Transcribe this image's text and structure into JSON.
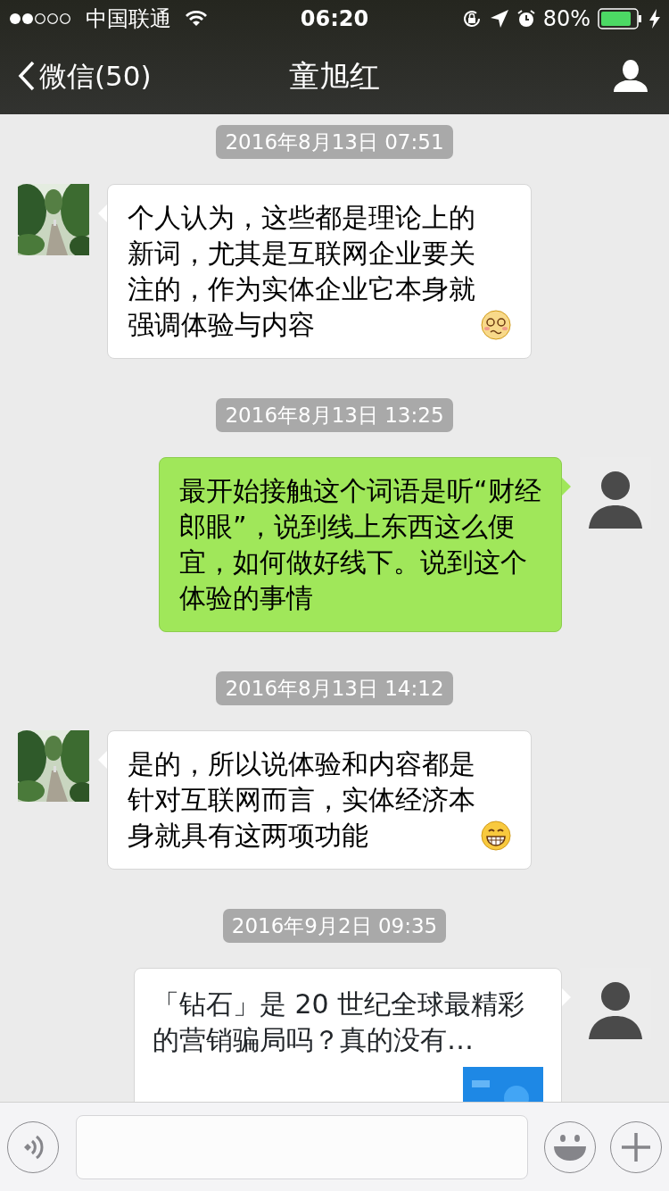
{
  "status_bar": {
    "carrier": "中国联通",
    "time": "06:20",
    "battery": "80%"
  },
  "nav": {
    "back_label": "微信(50)",
    "title": "童旭红"
  },
  "messages": [
    {
      "kind": "timestamp",
      "text": "2016年8月13日 07:51"
    },
    {
      "kind": "text",
      "outgoing": false,
      "text": "个人认为，这些都是理论上的新词，尤其是互联网企业要关注的，作为实体企业它本身就强调体验与内容",
      "emoji": {
        "kind": "dizzy"
      }
    },
    {
      "kind": "timestamp",
      "text": "2016年8月13日 13:25"
    },
    {
      "kind": "text",
      "outgoing": true,
      "text": "最开始接触这个词语是听“财经郎眼”，说到线上东西这么便宜，如何做好线下。说到这个体验的事情"
    },
    {
      "kind": "timestamp",
      "text": "2016年8月13日 14:12"
    },
    {
      "kind": "text",
      "outgoing": false,
      "text": "是的，所以说体验和内容都是针对互联网而言，实体经济本身就具有这两项功能",
      "emoji": {
        "kind": "grin"
      }
    },
    {
      "kind": "timestamp",
      "text": "2016年9月2日 09:35"
    },
    {
      "kind": "link",
      "outgoing": true,
      "title": "「钻石」是 20 世纪全球最精彩的营销骗局吗？真的没有…"
    }
  ]
}
